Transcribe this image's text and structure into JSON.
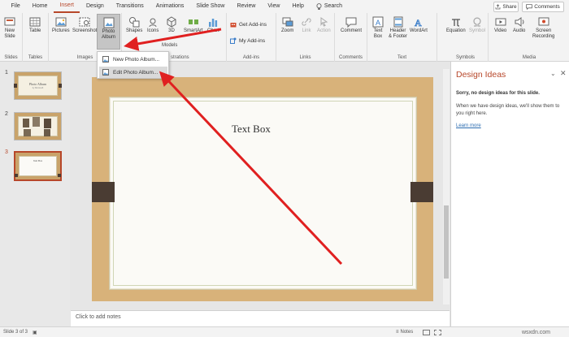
{
  "tabs": {
    "file": "File",
    "home": "Home",
    "insert": "Insert",
    "design": "Design",
    "transitions": "Transitions",
    "animations": "Animations",
    "slideshow": "Slide Show",
    "review": "Review",
    "view": "View",
    "help": "Help",
    "search": "Search"
  },
  "share": "Share",
  "comments": "Comments",
  "ribbon": {
    "new_slide": [
      "New",
      "Slide"
    ],
    "slides_group": "Slides",
    "table": "Table",
    "tables_group": "Tables",
    "pictures": "Pictures",
    "screenshot": "Screenshot",
    "photo_album": [
      "Photo",
      "Album"
    ],
    "images_group": "Images",
    "shapes": "Shapes",
    "icons": "Icons",
    "threed_models": "3D",
    "smartart": "SmartArt",
    "chart": "Chart",
    "models": "Models",
    "illustrations_group": "strations",
    "get_addins": "Get Add-ins",
    "my_addins": "My Add-ins",
    "addins_group": "Add-ins",
    "zoom": "Zoom",
    "link": "Link",
    "action": "Action",
    "links_group": "Links",
    "comment": "Comment",
    "comments_group": "Comments",
    "text_box": [
      "Text",
      "Box"
    ],
    "header_footer": [
      "Header",
      "& Footer"
    ],
    "wordart": "WordArt",
    "text_group": "Text",
    "equation": "Equation",
    "symbol": "Symbol",
    "symbols_group": "Symbols",
    "video": "Video",
    "audio": "Audio",
    "screen_recording": [
      "Screen",
      "Recording"
    ],
    "media_group": "Media"
  },
  "menu": {
    "new_album": "New Photo Album...",
    "edit_album": "Edit Photo Album..."
  },
  "thumbs": [
    "1",
    "2",
    "3"
  ],
  "thumb1": {
    "title": "Photo Album",
    "sub": "by Microsoft"
  },
  "thumb3": {
    "text": "Text Box"
  },
  "slide": {
    "text_box": "Text Box"
  },
  "notes_placeholder": "Click to add notes",
  "design": {
    "title": "Design Ideas",
    "heading": "Sorry, no design ideas for this slide.",
    "body": "When we have design ideas, we'll show them to you right here.",
    "link": "Learn more"
  },
  "status": {
    "slide": "Slide 3 of 3",
    "notes": "Notes",
    "watermark": "wsxdn.com"
  },
  "colors": {
    "accent": "#b7472a",
    "arrow": "#e02020"
  }
}
